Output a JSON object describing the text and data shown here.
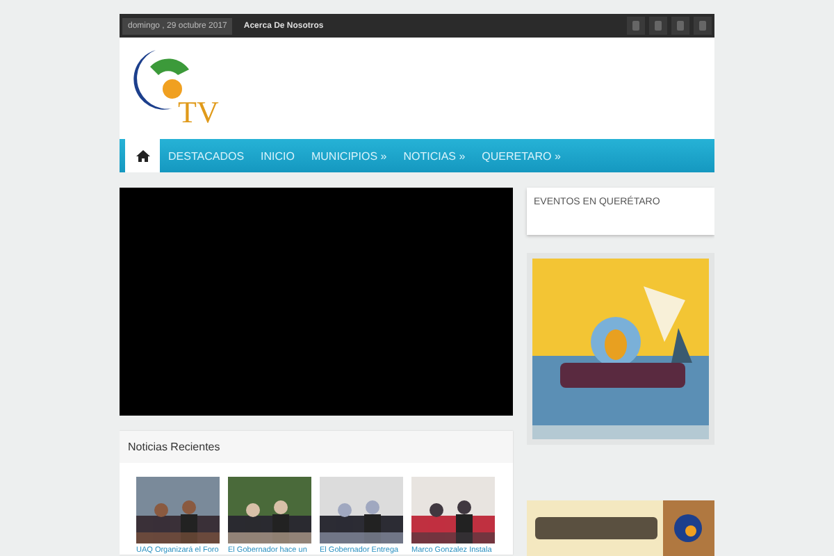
{
  "top_bar": {
    "date": "domingo , 29 octubre 2017",
    "links": [
      "Acerca De Nosotros"
    ]
  },
  "logo": {
    "text": "TV"
  },
  "nav": {
    "items": [
      {
        "label": "DESTACADOS",
        "selected": false
      },
      {
        "label": "INICIO",
        "selected": false
      },
      {
        "label": "MUNICIPIOS »",
        "selected": false
      },
      {
        "label": "NOTICIAS »",
        "selected": false
      },
      {
        "label": "QUERETARO »",
        "selected": false
      }
    ],
    "home_selected": true
  },
  "recent_news": {
    "title": "Noticias Recientes",
    "items": [
      {
        "caption": "UAQ Organizará el Foro"
      },
      {
        "caption": "El Gobernador hace un"
      },
      {
        "caption": "El Gobernador Entrega"
      },
      {
        "caption": "Marco Gonzalez Instala"
      }
    ]
  },
  "sidebar": {
    "events_title": "EVENTOS EN QUERÉTARO"
  }
}
